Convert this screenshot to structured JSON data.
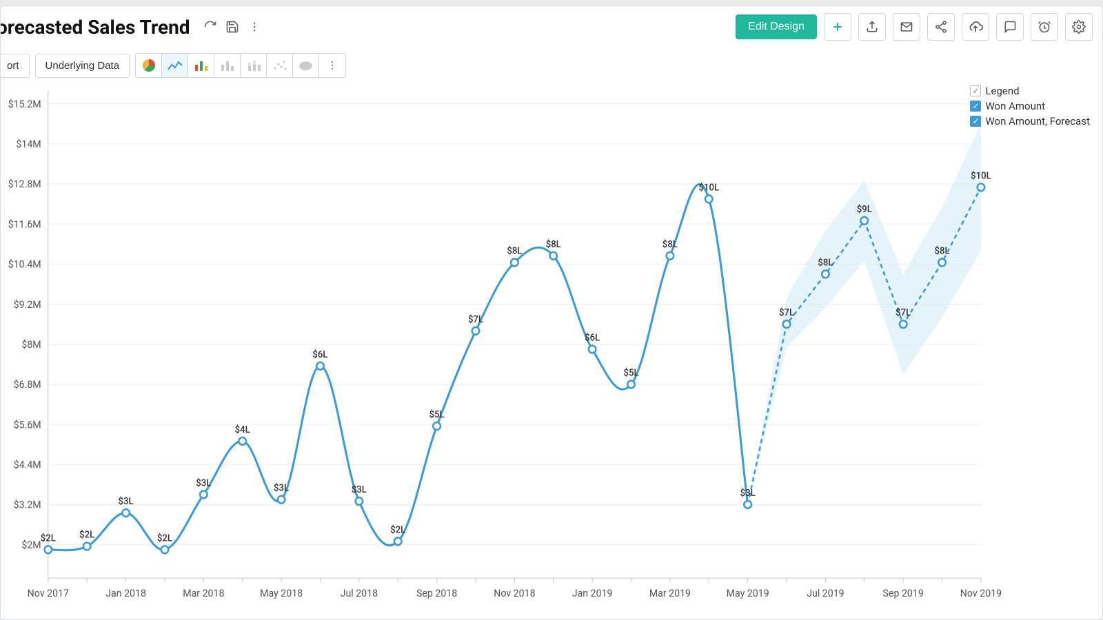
{
  "title": "orecasted Sales Trend",
  "toolbar": {
    "edit_design": "Edit Design",
    "sort": "ort",
    "underlying_data": "Underlying Data"
  },
  "legend": {
    "title": "Legend",
    "series1": "Won Amount",
    "series2": "Won Amount, Forecast"
  },
  "chart_data": {
    "type": "line",
    "title": "Forecasted Sales Trend",
    "xlabel": "",
    "ylabel": "",
    "y_ticks": [
      "$2M",
      "$3.2M",
      "$4.4M",
      "$5.6M",
      "$6.8M",
      "$8M",
      "$9.2M",
      "$10.4M",
      "$11.6M",
      "$12.8M",
      "$14M",
      "$15.2M"
    ],
    "y_tick_values_m": [
      2.0,
      3.2,
      4.4,
      5.6,
      6.8,
      8.0,
      9.2,
      10.4,
      11.6,
      12.8,
      14.0,
      15.2
    ],
    "ylim_m": [
      1.0,
      15.6
    ],
    "months": [
      "Nov 2017",
      "Dec 2017",
      "Jan 2018",
      "Feb 2018",
      "Mar 2018",
      "Apr 2018",
      "May 2018",
      "Jun 2018",
      "Jul 2018",
      "Aug 2018",
      "Sep 2018",
      "Oct 2018",
      "Nov 2018",
      "Dec 2018",
      "Jan 2019",
      "Feb 2019",
      "Mar 2019",
      "Apr 2019",
      "May 2019",
      "Jun 2019",
      "Jul 2019",
      "Aug 2019",
      "Sep 2019",
      "Oct 2019",
      "Nov 2019"
    ],
    "x_tick_labels": [
      "Nov 2017",
      "Jan 2018",
      "Mar 2018",
      "May 2018",
      "Jul 2018",
      "Sep 2018",
      "Nov 2018",
      "Jan 2019",
      "Mar 2019",
      "May 2019",
      "Jul 2019",
      "Sep 2019",
      "Nov 2019"
    ],
    "series": [
      {
        "name": "Won Amount",
        "style": "solid",
        "points": [
          {
            "x": "Nov 2017",
            "y_m": 1.85,
            "label": "$2L"
          },
          {
            "x": "Dec 2017",
            "y_m": 1.95,
            "label": "$2L"
          },
          {
            "x": "Jan 2018",
            "y_m": 2.95,
            "label": "$3L"
          },
          {
            "x": "Feb 2018",
            "y_m": 1.85,
            "label": "$2L"
          },
          {
            "x": "Mar 2018",
            "y_m": 3.5,
            "label": "$3L"
          },
          {
            "x": "Apr 2018",
            "y_m": 5.1,
            "label": "$4L"
          },
          {
            "x": "May 2018",
            "y_m": 3.35,
            "label": "$3L"
          },
          {
            "x": "Jun 2018",
            "y_m": 7.35,
            "label": "$6L"
          },
          {
            "x": "Jul 2018",
            "y_m": 3.3,
            "label": "$3L"
          },
          {
            "x": "Aug 2018",
            "y_m": 2.1,
            "label": "$2L"
          },
          {
            "x": "Sep 2018",
            "y_m": 5.55,
            "label": "$5L"
          },
          {
            "x": "Oct 2018",
            "y_m": 8.4,
            "label": "$7L"
          },
          {
            "x": "Nov 2018",
            "y_m": 10.45,
            "label": "$8L"
          },
          {
            "x": "Dec 2018",
            "y_m": 10.65,
            "label": "$8L"
          },
          {
            "x": "Jan 2019",
            "y_m": 7.85,
            "label": "$6L"
          },
          {
            "x": "Feb 2019",
            "y_m": 6.8,
            "label": "$5L"
          },
          {
            "x": "Mar 2019",
            "y_m": 10.65,
            "label": "$8L"
          },
          {
            "x": "Apr 2019",
            "y_m": 12.35,
            "label": "$10L"
          },
          {
            "x": "May 2019",
            "y_m": 3.2,
            "label": "$3L"
          }
        ]
      },
      {
        "name": "Won Amount, Forecast",
        "style": "dashed",
        "points": [
          {
            "x": "May 2019",
            "y_m": 3.2,
            "label": ""
          },
          {
            "x": "Jun 2019",
            "y_m": 8.6,
            "label": "$7L"
          },
          {
            "x": "Jul 2019",
            "y_m": 10.1,
            "label": "$8L"
          },
          {
            "x": "Aug 2019",
            "y_m": 11.7,
            "label": "$9L"
          },
          {
            "x": "Sep 2019",
            "y_m": 8.6,
            "label": "$7L"
          },
          {
            "x": "Oct 2019",
            "y_m": 10.45,
            "label": "$8L"
          },
          {
            "x": "Nov 2019",
            "y_m": 12.7,
            "label": "$10L"
          }
        ],
        "confidence_band": [
          {
            "x": "May 2019",
            "lo_m": 3.2,
            "hi_m": 3.2
          },
          {
            "x": "Jun 2019",
            "lo_m": 7.9,
            "hi_m": 9.4
          },
          {
            "x": "Jul 2019",
            "lo_m": 9.1,
            "hi_m": 11.4
          },
          {
            "x": "Aug 2019",
            "lo_m": 10.5,
            "hi_m": 12.9
          },
          {
            "x": "Sep 2019",
            "lo_m": 7.1,
            "hi_m": 10.1
          },
          {
            "x": "Oct 2019",
            "lo_m": 8.8,
            "hi_m": 12.1
          },
          {
            "x": "Nov 2019",
            "lo_m": 10.8,
            "hi_m": 14.6
          }
        ]
      }
    ]
  }
}
